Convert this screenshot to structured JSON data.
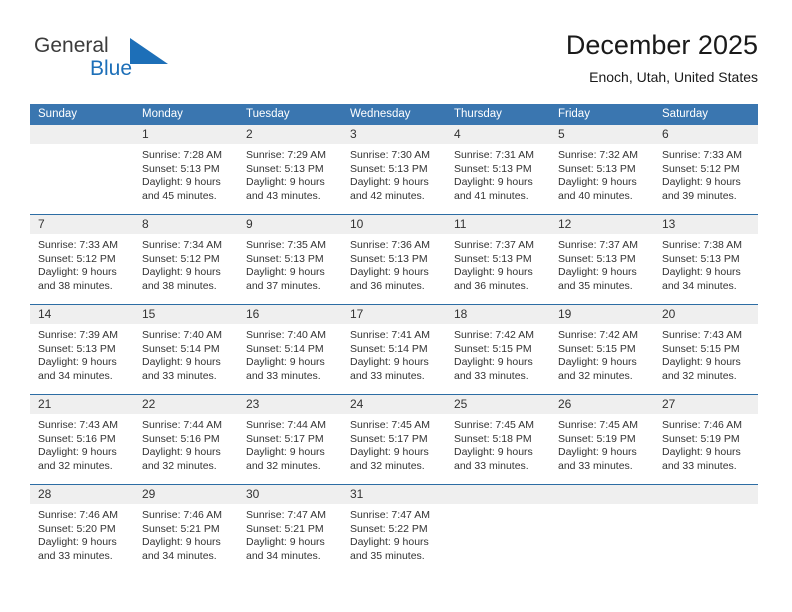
{
  "brand": {
    "name_part1": "General",
    "name_part2": "Blue",
    "triangle_color": "#1d6fb8"
  },
  "header": {
    "title": "December 2025",
    "subtitle": "Enoch, Utah, United States"
  },
  "theme": {
    "header_blue": "#3a76b0",
    "separator_blue": "#2d6da4",
    "daynum_band": "#efefef",
    "text": "#333333"
  },
  "weekdays": [
    "Sunday",
    "Monday",
    "Tuesday",
    "Wednesday",
    "Thursday",
    "Friday",
    "Saturday"
  ],
  "weeks": [
    [
      {
        "day": "",
        "lines": []
      },
      {
        "day": "1",
        "lines": [
          "Sunrise: 7:28 AM",
          "Sunset: 5:13 PM",
          "Daylight: 9 hours",
          "and 45 minutes."
        ]
      },
      {
        "day": "2",
        "lines": [
          "Sunrise: 7:29 AM",
          "Sunset: 5:13 PM",
          "Daylight: 9 hours",
          "and 43 minutes."
        ]
      },
      {
        "day": "3",
        "lines": [
          "Sunrise: 7:30 AM",
          "Sunset: 5:13 PM",
          "Daylight: 9 hours",
          "and 42 minutes."
        ]
      },
      {
        "day": "4",
        "lines": [
          "Sunrise: 7:31 AM",
          "Sunset: 5:13 PM",
          "Daylight: 9 hours",
          "and 41 minutes."
        ]
      },
      {
        "day": "5",
        "lines": [
          "Sunrise: 7:32 AM",
          "Sunset: 5:13 PM",
          "Daylight: 9 hours",
          "and 40 minutes."
        ]
      },
      {
        "day": "6",
        "lines": [
          "Sunrise: 7:33 AM",
          "Sunset: 5:12 PM",
          "Daylight: 9 hours",
          "and 39 minutes."
        ]
      }
    ],
    [
      {
        "day": "7",
        "lines": [
          "Sunrise: 7:33 AM",
          "Sunset: 5:12 PM",
          "Daylight: 9 hours",
          "and 38 minutes."
        ]
      },
      {
        "day": "8",
        "lines": [
          "Sunrise: 7:34 AM",
          "Sunset: 5:12 PM",
          "Daylight: 9 hours",
          "and 38 minutes."
        ]
      },
      {
        "day": "9",
        "lines": [
          "Sunrise: 7:35 AM",
          "Sunset: 5:13 PM",
          "Daylight: 9 hours",
          "and 37 minutes."
        ]
      },
      {
        "day": "10",
        "lines": [
          "Sunrise: 7:36 AM",
          "Sunset: 5:13 PM",
          "Daylight: 9 hours",
          "and 36 minutes."
        ]
      },
      {
        "day": "11",
        "lines": [
          "Sunrise: 7:37 AM",
          "Sunset: 5:13 PM",
          "Daylight: 9 hours",
          "and 36 minutes."
        ]
      },
      {
        "day": "12",
        "lines": [
          "Sunrise: 7:37 AM",
          "Sunset: 5:13 PM",
          "Daylight: 9 hours",
          "and 35 minutes."
        ]
      },
      {
        "day": "13",
        "lines": [
          "Sunrise: 7:38 AM",
          "Sunset: 5:13 PM",
          "Daylight: 9 hours",
          "and 34 minutes."
        ]
      }
    ],
    [
      {
        "day": "14",
        "lines": [
          "Sunrise: 7:39 AM",
          "Sunset: 5:13 PM",
          "Daylight: 9 hours",
          "and 34 minutes."
        ]
      },
      {
        "day": "15",
        "lines": [
          "Sunrise: 7:40 AM",
          "Sunset: 5:14 PM",
          "Daylight: 9 hours",
          "and 33 minutes."
        ]
      },
      {
        "day": "16",
        "lines": [
          "Sunrise: 7:40 AM",
          "Sunset: 5:14 PM",
          "Daylight: 9 hours",
          "and 33 minutes."
        ]
      },
      {
        "day": "17",
        "lines": [
          "Sunrise: 7:41 AM",
          "Sunset: 5:14 PM",
          "Daylight: 9 hours",
          "and 33 minutes."
        ]
      },
      {
        "day": "18",
        "lines": [
          "Sunrise: 7:42 AM",
          "Sunset: 5:15 PM",
          "Daylight: 9 hours",
          "and 33 minutes."
        ]
      },
      {
        "day": "19",
        "lines": [
          "Sunrise: 7:42 AM",
          "Sunset: 5:15 PM",
          "Daylight: 9 hours",
          "and 32 minutes."
        ]
      },
      {
        "day": "20",
        "lines": [
          "Sunrise: 7:43 AM",
          "Sunset: 5:15 PM",
          "Daylight: 9 hours",
          "and 32 minutes."
        ]
      }
    ],
    [
      {
        "day": "21",
        "lines": [
          "Sunrise: 7:43 AM",
          "Sunset: 5:16 PM",
          "Daylight: 9 hours",
          "and 32 minutes."
        ]
      },
      {
        "day": "22",
        "lines": [
          "Sunrise: 7:44 AM",
          "Sunset: 5:16 PM",
          "Daylight: 9 hours",
          "and 32 minutes."
        ]
      },
      {
        "day": "23",
        "lines": [
          "Sunrise: 7:44 AM",
          "Sunset: 5:17 PM",
          "Daylight: 9 hours",
          "and 32 minutes."
        ]
      },
      {
        "day": "24",
        "lines": [
          "Sunrise: 7:45 AM",
          "Sunset: 5:17 PM",
          "Daylight: 9 hours",
          "and 32 minutes."
        ]
      },
      {
        "day": "25",
        "lines": [
          "Sunrise: 7:45 AM",
          "Sunset: 5:18 PM",
          "Daylight: 9 hours",
          "and 33 minutes."
        ]
      },
      {
        "day": "26",
        "lines": [
          "Sunrise: 7:45 AM",
          "Sunset: 5:19 PM",
          "Daylight: 9 hours",
          "and 33 minutes."
        ]
      },
      {
        "day": "27",
        "lines": [
          "Sunrise: 7:46 AM",
          "Sunset: 5:19 PM",
          "Daylight: 9 hours",
          "and 33 minutes."
        ]
      }
    ],
    [
      {
        "day": "28",
        "lines": [
          "Sunrise: 7:46 AM",
          "Sunset: 5:20 PM",
          "Daylight: 9 hours",
          "and 33 minutes."
        ]
      },
      {
        "day": "29",
        "lines": [
          "Sunrise: 7:46 AM",
          "Sunset: 5:21 PM",
          "Daylight: 9 hours",
          "and 34 minutes."
        ]
      },
      {
        "day": "30",
        "lines": [
          "Sunrise: 7:47 AM",
          "Sunset: 5:21 PM",
          "Daylight: 9 hours",
          "and 34 minutes."
        ]
      },
      {
        "day": "31",
        "lines": [
          "Sunrise: 7:47 AM",
          "Sunset: 5:22 PM",
          "Daylight: 9 hours",
          "and 35 minutes."
        ]
      },
      {
        "day": "",
        "lines": []
      },
      {
        "day": "",
        "lines": []
      },
      {
        "day": "",
        "lines": []
      }
    ]
  ]
}
